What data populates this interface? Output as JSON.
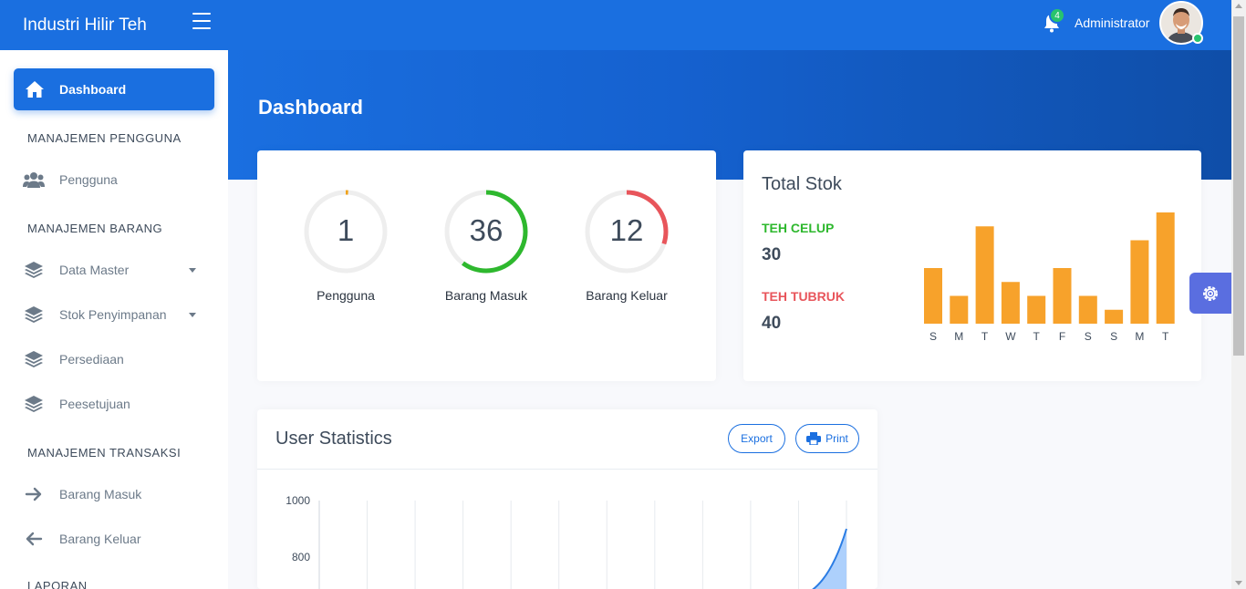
{
  "app": {
    "brand": "Industri Hilir Teh"
  },
  "header": {
    "notification_count": "4",
    "user_name": "Administrator",
    "page_title": "Dashboard"
  },
  "sidebar": {
    "active_item": {
      "label": "Dashboard",
      "icon": "home-icon"
    },
    "sections": [
      {
        "title": "MANAJEMEN PENGGUNA",
        "items": [
          {
            "label": "Pengguna",
            "icon": "users-icon"
          }
        ]
      },
      {
        "title": "MANAJEMEN BARANG",
        "items": [
          {
            "label": "Data Master",
            "icon": "layers-icon",
            "has_submenu": true
          },
          {
            "label": "Stok Penyimpanan",
            "icon": "layers-icon",
            "has_submenu": true
          },
          {
            "label": "Persediaan",
            "icon": "layers-icon"
          },
          {
            "label": "Peesetujuan",
            "icon": "layers-icon"
          }
        ]
      },
      {
        "title": "MANAJEMEN TRANSAKSI",
        "items": [
          {
            "label": "Barang Masuk",
            "icon": "arrow-right-icon"
          },
          {
            "label": "Barang Keluar",
            "icon": "arrow-left-icon"
          }
        ]
      },
      {
        "title": "LAPORAN",
        "items": []
      }
    ]
  },
  "stats": [
    {
      "value": "1",
      "label": "Pengguna",
      "progress": 0.01,
      "color": "#f0a21b"
    },
    {
      "value": "36",
      "label": "Barang Masuk",
      "progress": 0.6,
      "color": "#2eb82e"
    },
    {
      "value": "12",
      "label": "Barang Keluar",
      "progress": 0.3,
      "color": "#e8555b"
    }
  ],
  "total_stok": {
    "title": "Total Stok",
    "items": [
      {
        "label": "TEH CELUP",
        "value": "30",
        "color": "#2eb82e"
      },
      {
        "label": "TEH TUBRUK",
        "value": "40",
        "color": "#e8555b"
      }
    ],
    "bar_color": "#f7a22b"
  },
  "user_statistics": {
    "title": "User Statistics",
    "export_label": "Export",
    "print_label": "Print",
    "area_color": "#9fc8fb",
    "line_color": "#2a7ce4"
  },
  "chart_data": [
    {
      "type": "bar",
      "title": "",
      "categories": [
        "S",
        "M",
        "T",
        "W",
        "T",
        "F",
        "S",
        "S",
        "M",
        "T"
      ],
      "values": [
        8,
        4,
        14,
        6,
        4,
        8,
        4,
        2,
        12,
        16
      ],
      "ylim": [
        0,
        16
      ],
      "grid": false
    },
    {
      "type": "area",
      "title": "",
      "x": [
        0,
        1,
        2,
        3,
        4,
        5,
        6,
        7,
        8,
        9,
        10,
        11
      ],
      "y": [
        0,
        0,
        0,
        0,
        0,
        0,
        0,
        0,
        0,
        0,
        650,
        900
      ],
      "yticks": [
        "1000",
        "800"
      ],
      "ylim": [
        0,
        1000
      ],
      "grid": true
    }
  ]
}
